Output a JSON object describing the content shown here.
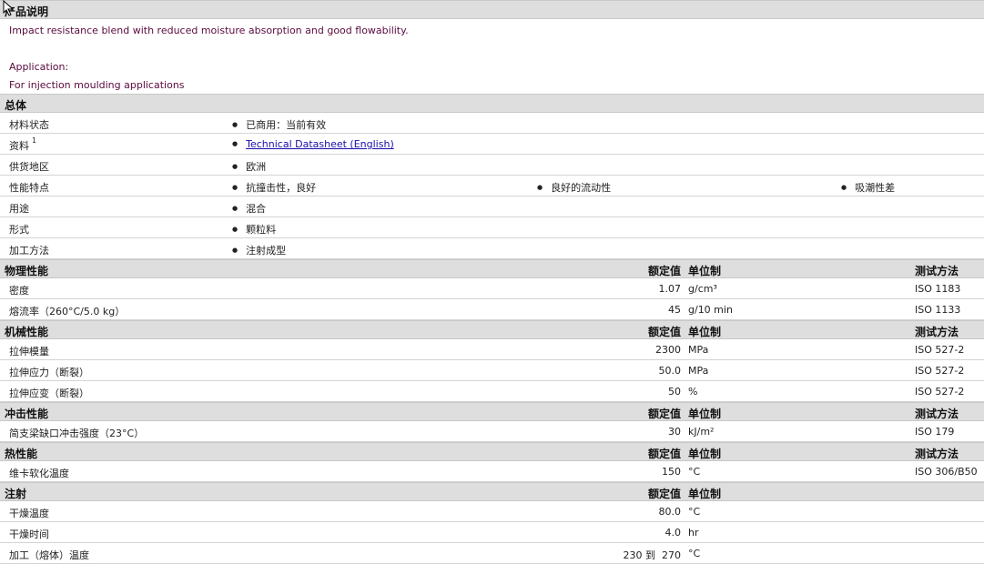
{
  "product_description": {
    "title": "产品说明",
    "lines": [
      "Impact resistance blend with reduced moisture absorption and good flowability.",
      "Application:",
      "For injection moulding applications"
    ]
  },
  "general": {
    "title": "总体",
    "rows": [
      {
        "label": "材料状态",
        "values": [
          "已商用：当前有效"
        ]
      },
      {
        "label": "资料",
        "sup": "1",
        "link": "Technical Datasheet (English)"
      },
      {
        "label": "供货地区",
        "values": [
          "欧洲"
        ]
      },
      {
        "label": "性能特点",
        "values": [
          "抗撞击性，良好",
          "良好的流动性",
          "吸潮性差"
        ]
      },
      {
        "label": "用途",
        "values": [
          "混合"
        ]
      },
      {
        "label": "形式",
        "values": [
          "颗粒料"
        ]
      },
      {
        "label": "加工方法",
        "values": [
          "注射成型"
        ]
      }
    ]
  },
  "headers": {
    "nominal": "额定值",
    "unit": "单位制",
    "test": "测试方法"
  },
  "physical": {
    "title": "物理性能",
    "rows": [
      {
        "label": "密度",
        "value": "1.07",
        "unit": "g/cm³",
        "test": "ISO 1183"
      },
      {
        "label": "熔流率（260°C/5.0 kg）",
        "value": "45",
        "unit": "g/10 min",
        "test": "ISO 1133"
      }
    ]
  },
  "mechanical": {
    "title": "机械性能",
    "rows": [
      {
        "label": "拉伸模量",
        "value": "2300",
        "unit": "MPa",
        "test": "ISO 527-2"
      },
      {
        "label": "拉伸应力（断裂）",
        "value": "50.0",
        "unit": "MPa",
        "test": "ISO 527-2"
      },
      {
        "label": "拉伸应变（断裂）",
        "value": "50",
        "unit": "%",
        "test": "ISO 527-2"
      }
    ]
  },
  "impact": {
    "title": "冲击性能",
    "rows": [
      {
        "label": "简支梁缺口冲击强度（23°C）",
        "value": "30",
        "unit": "kJ/m²",
        "test": "ISO 179"
      }
    ]
  },
  "thermal": {
    "title": "热性能",
    "rows": [
      {
        "label": "维卡软化温度",
        "value": "150",
        "unit": "°C",
        "test": "ISO 306/B50"
      }
    ]
  },
  "injection": {
    "title": "注射",
    "rows": [
      {
        "label": "干燥温度",
        "value": "80.0",
        "unit": "°C"
      },
      {
        "label": "干燥时间",
        "value": "4.0",
        "unit": "hr"
      },
      {
        "label": "加工（熔体）温度",
        "value": "230 到  270",
        "unit": "°C"
      }
    ]
  },
  "icons": {
    "cursor": "mouse-pointer-icon",
    "bullet": "bullet-dot-icon"
  }
}
